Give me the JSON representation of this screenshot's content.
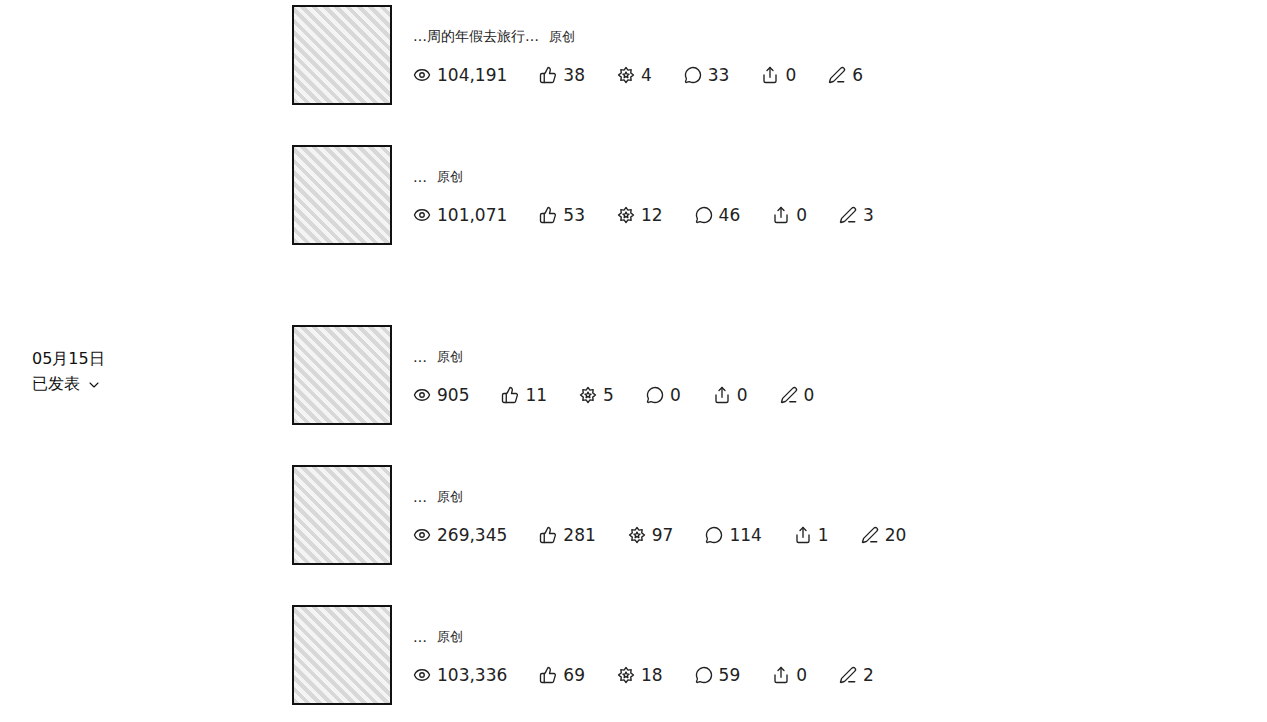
{
  "groups": [
    {
      "articles": [
        {
          "title": "…周的年假去旅行…",
          "badge": "原创",
          "stats": {
            "views": "104,191",
            "likes": "38",
            "wows": "4",
            "comments": "33",
            "shares": "0",
            "notes": "6"
          }
        },
        {
          "title": "…",
          "badge": "原创",
          "stats": {
            "views": "101,071",
            "likes": "53",
            "wows": "12",
            "comments": "46",
            "shares": "0",
            "notes": "3"
          }
        }
      ]
    },
    {
      "date": "05月15日",
      "status": "已发表",
      "articles": [
        {
          "title": "…",
          "badge": "原创",
          "stats": {
            "views": "905",
            "likes": "11",
            "wows": "5",
            "comments": "0",
            "shares": "0",
            "notes": "0"
          }
        },
        {
          "title": "…",
          "badge": "原创",
          "stats": {
            "views": "269,345",
            "likes": "281",
            "wows": "97",
            "comments": "114",
            "shares": "1",
            "notes": "20"
          }
        },
        {
          "title": "…",
          "badge": "原创",
          "stats": {
            "views": "103,336",
            "likes": "69",
            "wows": "18",
            "comments": "59",
            "shares": "0",
            "notes": "2"
          }
        }
      ]
    }
  ]
}
